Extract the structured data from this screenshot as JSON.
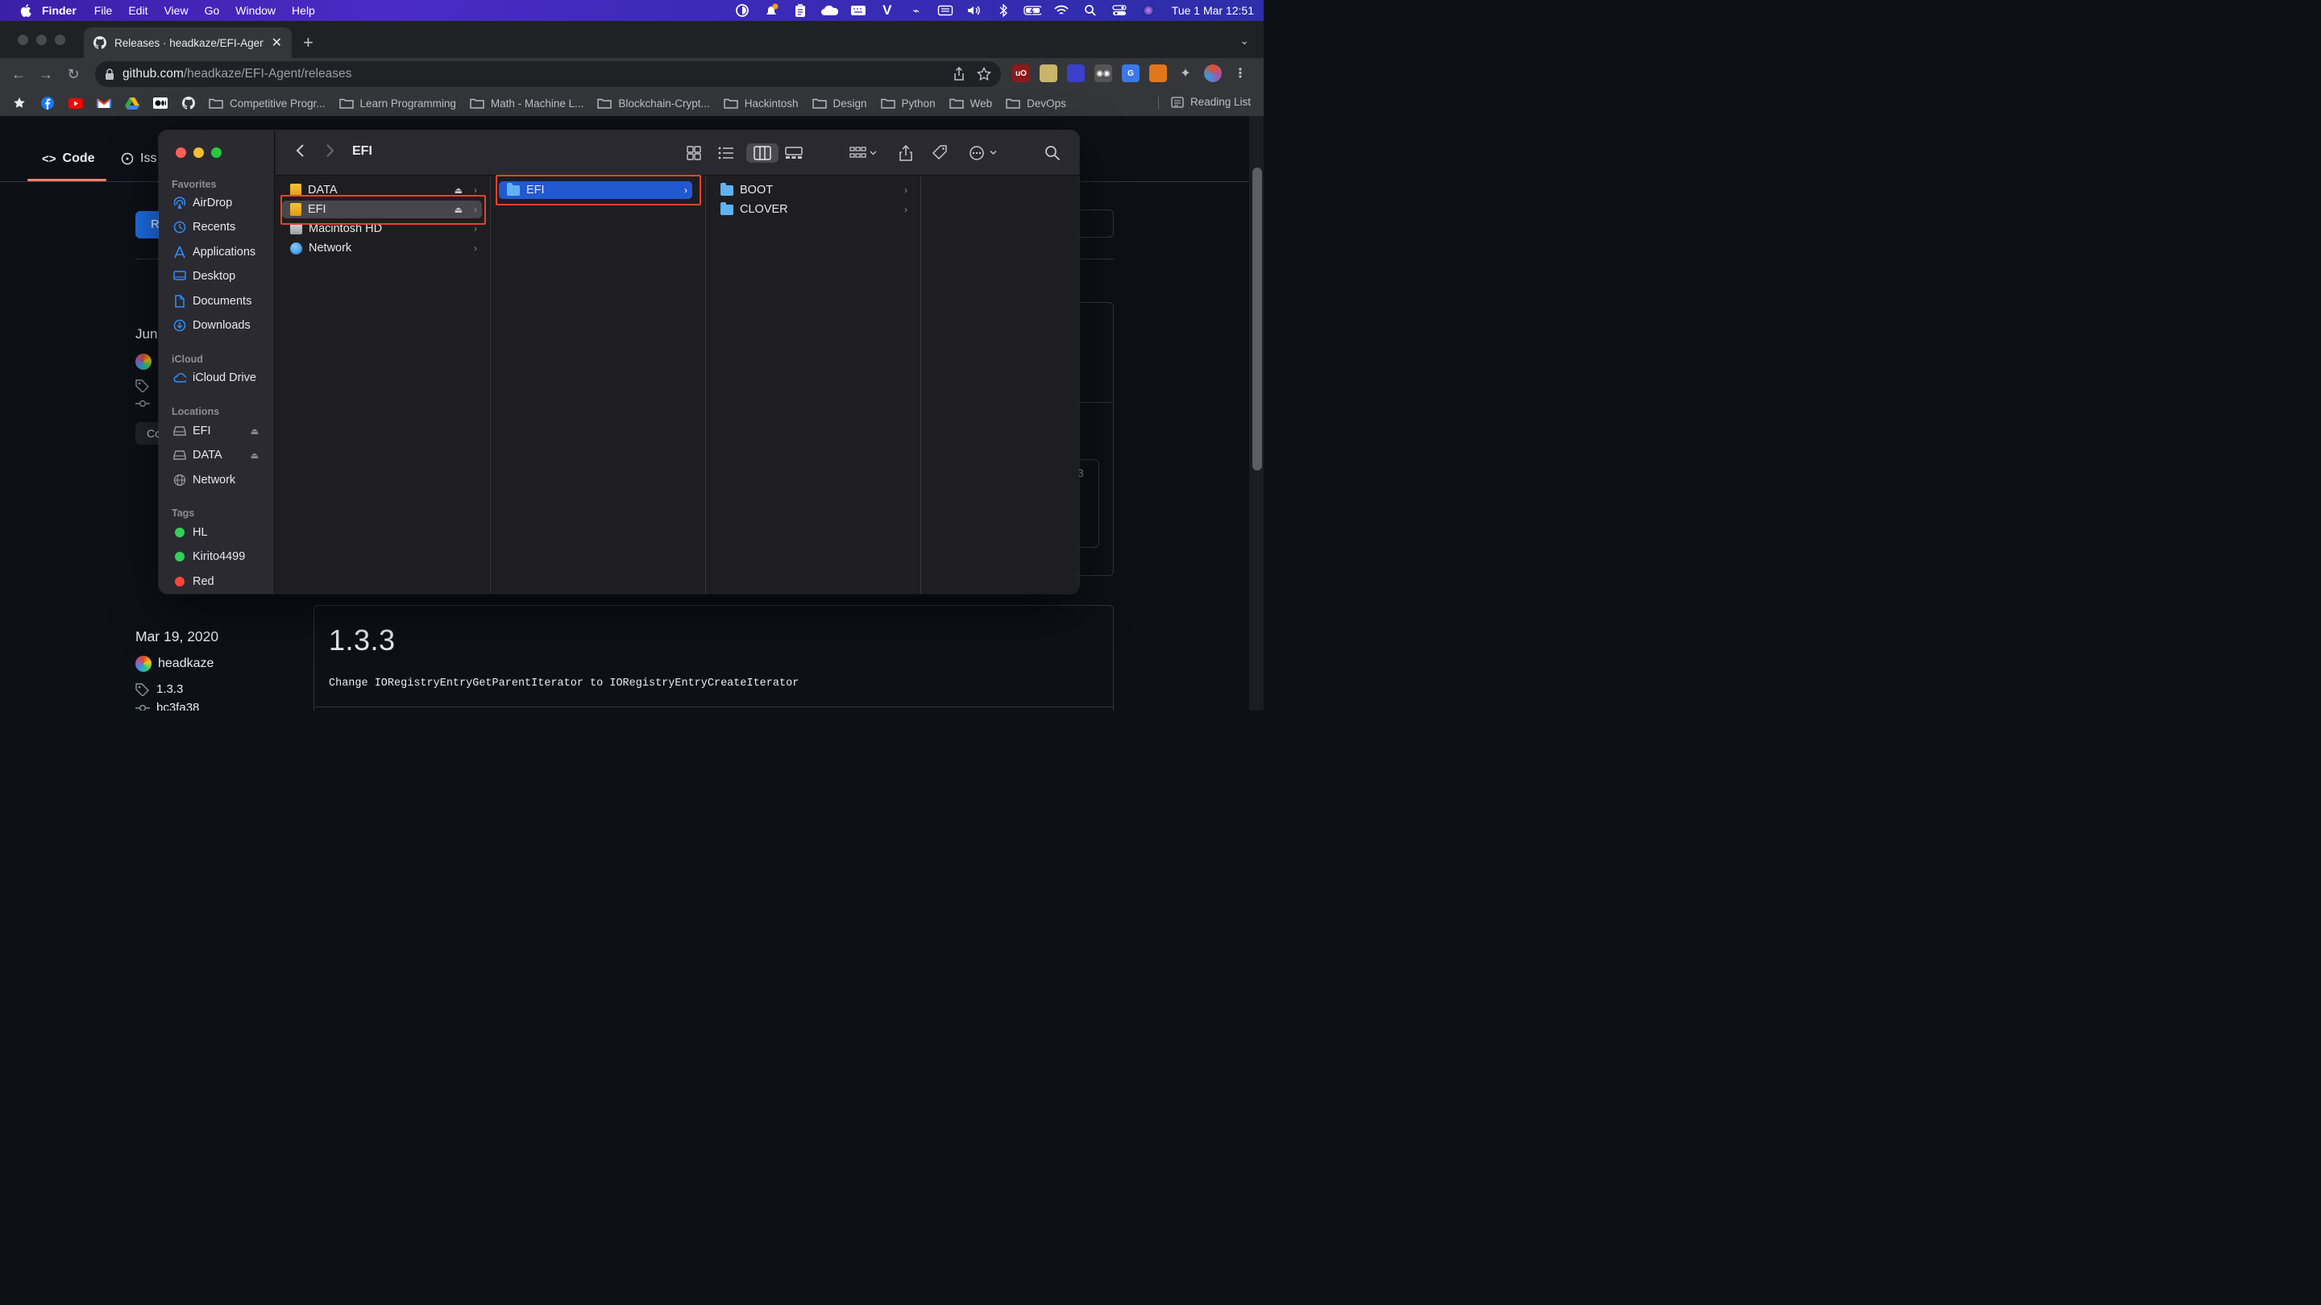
{
  "menubar": {
    "app": "Finder",
    "items": [
      "File",
      "Edit",
      "View",
      "Go",
      "Window",
      "Help"
    ],
    "clock": "Tue 1 Mar  12:51",
    "status_icons": [
      "focus-icon",
      "notification-icon",
      "clipboard-icon",
      "cloud-icon",
      "keyboard-icon",
      "v-icon",
      "script-icon",
      "input-source-icon",
      "volume-icon",
      "bluetooth-icon",
      "battery-icon",
      "wifi-icon",
      "spotlight-icon",
      "control-center-icon",
      "siri-icon"
    ]
  },
  "browser": {
    "tab_title": "Releases · headkaze/EFI-Agent",
    "url_domain": "github.com",
    "url_path": "/headkaze/EFI-Agent/releases",
    "extensions": [
      {
        "name": "ublock-icon",
        "badge": "9",
        "color": "#8b1a1a"
      },
      {
        "name": "notes-ext-icon",
        "badge": "",
        "color": "#c8b56a"
      },
      {
        "name": "ext-blue-icon",
        "badge": "4",
        "color": "#3b3fc9"
      },
      {
        "name": "eyes-ext-icon",
        "badge": "",
        "color": "#444"
      },
      {
        "name": "translate-icon",
        "badge": "",
        "color": "#3b78e7"
      },
      {
        "name": "metamask-icon",
        "badge": "",
        "color": "#e2761b"
      },
      {
        "name": "extensions-puzzle-icon",
        "badge": "",
        "color": "#35363a"
      }
    ],
    "bookmarks": [
      "Competitive Progr...",
      "Learn Programming",
      "Math - Machine L...",
      "Blockchain-Crypt...",
      "Hackintosh",
      "Design",
      "Python",
      "Web",
      "DevOps"
    ],
    "reading_list": "Reading List"
  },
  "github": {
    "nav_code": "Code",
    "nav_issues": "Iss",
    "release_btn_fragment": "R",
    "side_date_fragment": "Jun",
    "side_commit_fragment": "Co",
    "side_right_fragment": "3",
    "release": {
      "date": "Mar 19, 2020",
      "author": "headkaze",
      "tag": "1.3.3",
      "commit": "bc3fa38",
      "title": "1.3.3",
      "body": "Change IORegistryEntryGetParentIterator to IORegistryEntryCreateIterator"
    }
  },
  "finder": {
    "title": "EFI",
    "sidebar": {
      "favorites_title": "Favorites",
      "favorites": [
        {
          "label": "AirDrop",
          "icon": "airdrop-icon"
        },
        {
          "label": "Recents",
          "icon": "clock-icon"
        },
        {
          "label": "Applications",
          "icon": "applications-icon"
        },
        {
          "label": "Desktop",
          "icon": "desktop-icon"
        },
        {
          "label": "Documents",
          "icon": "document-icon"
        },
        {
          "label": "Downloads",
          "icon": "download-icon"
        }
      ],
      "icloud_title": "iCloud",
      "icloud": [
        {
          "label": "iCloud Drive",
          "icon": "cloud-icon"
        }
      ],
      "locations_title": "Locations",
      "locations": [
        {
          "label": "EFI",
          "icon": "disk-icon"
        },
        {
          "label": "DATA",
          "icon": "disk-icon"
        },
        {
          "label": "Network",
          "icon": "globe-icon"
        }
      ],
      "tags_title": "Tags",
      "tags": [
        {
          "label": "HL",
          "color": "#30d158"
        },
        {
          "label": "Kirito4499",
          "color": "#30d158"
        },
        {
          "label": "Red",
          "color": "#ff453a"
        }
      ]
    },
    "columns": [
      [
        {
          "label": "DATA",
          "kind": "drive"
        },
        {
          "label": "EFI",
          "kind": "drive"
        },
        {
          "label": "Macintosh HD",
          "kind": "hd"
        },
        {
          "label": "Network",
          "kind": "network"
        }
      ],
      [
        {
          "label": "EFI",
          "kind": "folder"
        }
      ],
      [
        {
          "label": "BOOT",
          "kind": "folder"
        },
        {
          "label": "CLOVER",
          "kind": "folder"
        }
      ]
    ]
  }
}
